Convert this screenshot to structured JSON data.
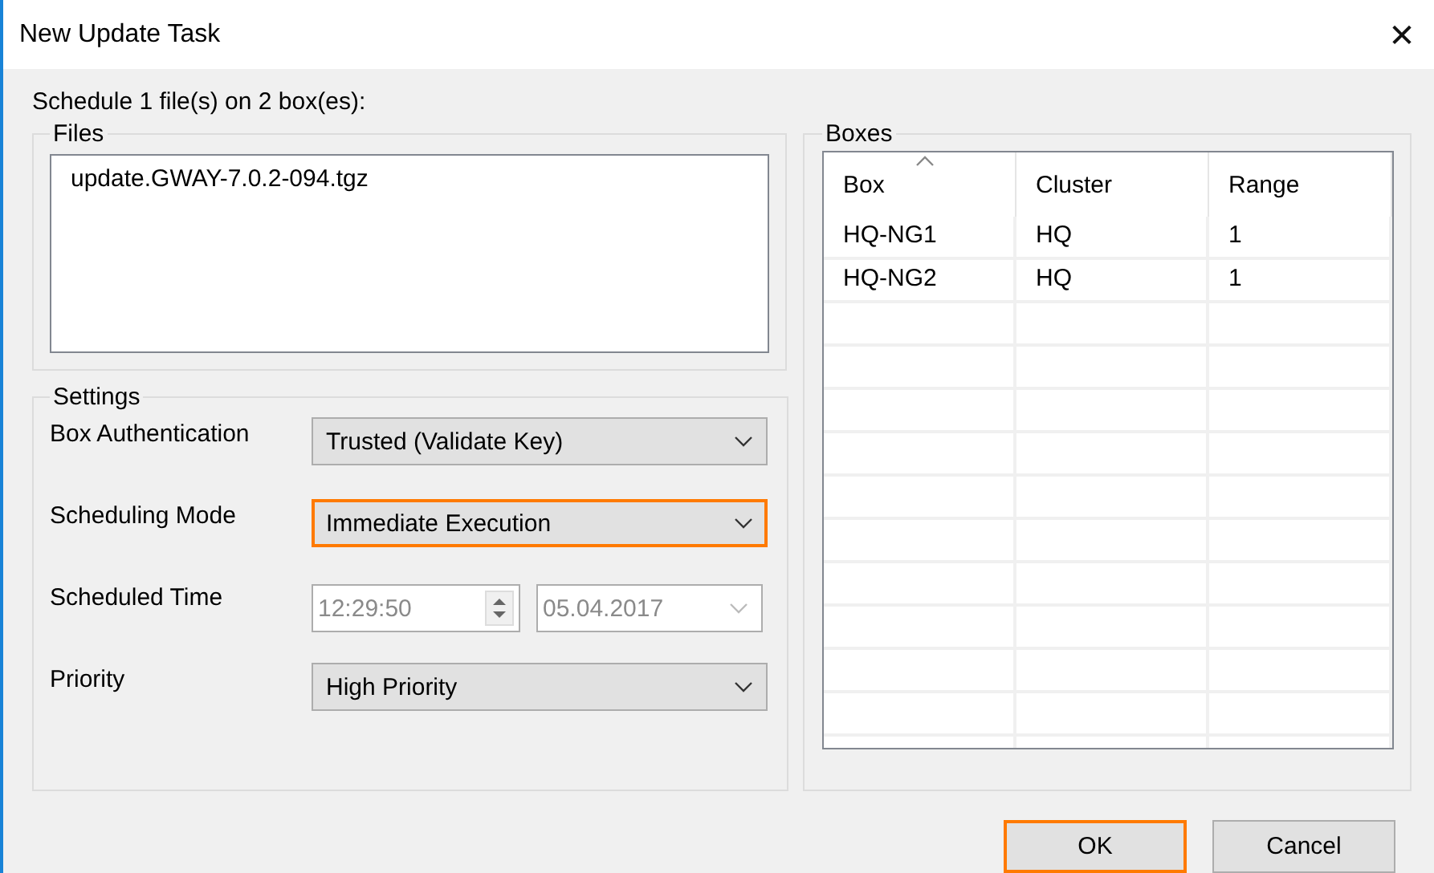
{
  "window": {
    "title": "New Update Task",
    "close": "✕"
  },
  "summary": "Schedule 1 file(s) on 2 box(es):",
  "files": {
    "title": "Files",
    "items": [
      "update.GWAY-7.0.2-094.tgz"
    ]
  },
  "settings": {
    "title": "Settings",
    "rows": [
      {
        "label": "Box Authentication",
        "kind": "combo",
        "value": "Trusted (Validate Key)",
        "highlighted": false,
        "disabled": false
      },
      {
        "label": "Scheduling Mode",
        "kind": "combo",
        "value": "Immediate Execution",
        "highlighted": true,
        "disabled": false
      },
      {
        "label": "Scheduled Time",
        "kind": "time_date",
        "time": "12:29:50",
        "date": "05.04.2017",
        "disabled": true
      },
      {
        "label": "Priority",
        "kind": "combo",
        "value": "High Priority",
        "highlighted": false,
        "disabled": false
      }
    ]
  },
  "boxes": {
    "title": "Boxes",
    "columns": [
      {
        "label": "Box",
        "sorted": true
      },
      {
        "label": "Cluster",
        "sorted": false
      },
      {
        "label": "Range",
        "sorted": false
      }
    ],
    "rows": [
      [
        "HQ-NG1",
        "HQ",
        "1"
      ],
      [
        "HQ-NG2",
        "HQ",
        "1"
      ]
    ]
  },
  "buttons": [
    {
      "label": "OK",
      "highlighted": true
    },
    {
      "label": "Cancel",
      "highlighted": false
    }
  ]
}
